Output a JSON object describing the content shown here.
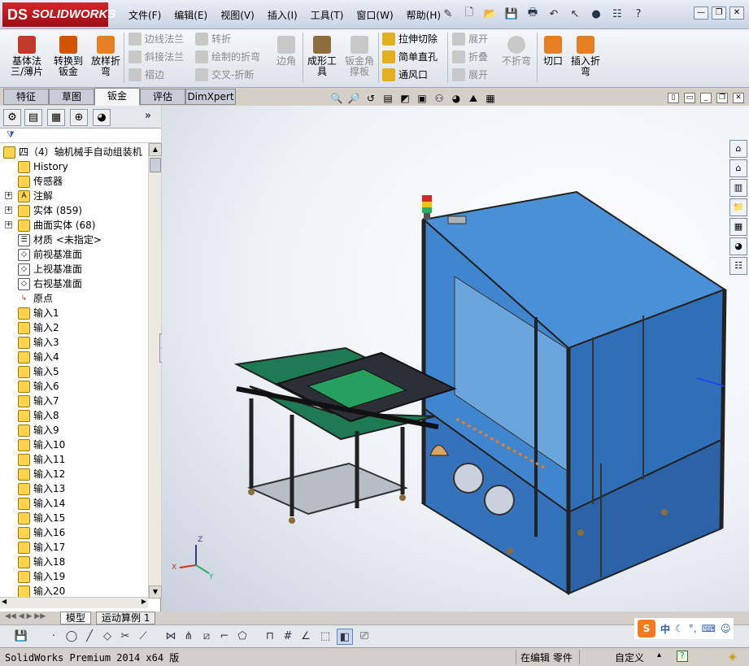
{
  "app": {
    "logo_prefix": "DS",
    "logo_text": "SOLIDWORKS"
  },
  "menubar": [
    {
      "label": "文件(F)"
    },
    {
      "label": "编辑(E)"
    },
    {
      "label": "视图(V)"
    },
    {
      "label": "插入(I)"
    },
    {
      "label": "工具(T)"
    },
    {
      "label": "窗口(W)"
    },
    {
      "label": "帮助(H)"
    }
  ],
  "ribbon": {
    "base_flange": "基体法\n三/薄片",
    "convert_to_sheet": "转换到\n钣金",
    "lofted_bend": "放样折\n弯",
    "edge_flange": "边线法兰",
    "miter_flange": "斜接法兰",
    "hem": "褶边",
    "jog": "转折",
    "sketched_bend": "绘制的折弯",
    "cross_break": "交叉-折断",
    "corner": "边角",
    "forming_tool": "成形工\n具",
    "gusset": "钣金角\n撑板",
    "extruded_cut": "拉伸切除",
    "simple_hole": "简单直孔",
    "vent": "通风口",
    "unfold": "展开",
    "fold": "折叠",
    "flatten": "展开",
    "no_bends": "不折弯",
    "rip": "切口",
    "insert_bends": "插入折\n弯"
  },
  "tabs": [
    {
      "label": "特征"
    },
    {
      "label": "草图"
    },
    {
      "label": "钣金"
    },
    {
      "label": "评估"
    },
    {
      "label": "DimXpert"
    }
  ],
  "tree": {
    "root": "四（4）轴机械手自动组装机",
    "items": [
      {
        "label": "History",
        "expand": false
      },
      {
        "label": "传感器",
        "expand": false
      },
      {
        "label": "注解",
        "expand": true
      },
      {
        "label": "实体 (859)",
        "expand": true
      },
      {
        "label": "曲面实体 (68)",
        "expand": true
      },
      {
        "label": "材质 <未指定>",
        "expand": false
      },
      {
        "label": "前视基准面",
        "expand": false
      },
      {
        "label": "上视基准面",
        "expand": false
      },
      {
        "label": "右视基准面",
        "expand": false
      },
      {
        "label": "原点",
        "expand": false
      },
      {
        "label": "输入1"
      },
      {
        "label": "输入2"
      },
      {
        "label": "输入3"
      },
      {
        "label": "输入4"
      },
      {
        "label": "输入5"
      },
      {
        "label": "输入6"
      },
      {
        "label": "输入7"
      },
      {
        "label": "输入8"
      },
      {
        "label": "输入9"
      },
      {
        "label": "输入10"
      },
      {
        "label": "输入11"
      },
      {
        "label": "输入12"
      },
      {
        "label": "输入13"
      },
      {
        "label": "输入14"
      },
      {
        "label": "输入15"
      },
      {
        "label": "输入16"
      },
      {
        "label": "输入17"
      },
      {
        "label": "输入18"
      },
      {
        "label": "输入19"
      },
      {
        "label": "输入20"
      }
    ]
  },
  "bottom_tabs": [
    {
      "label": "模型"
    },
    {
      "label": "运动算例 1"
    }
  ],
  "status": {
    "product": "SolidWorks Premium 2014 x64 版",
    "mode": "在编辑 零件",
    "units": "自定义"
  },
  "ime": {
    "brand": "S",
    "lang": "中"
  },
  "triad": {
    "x": "X",
    "y": "Y",
    "z": "Z"
  },
  "colors": {
    "cabinet_blue": "#2f6fb8",
    "cabinet_top": "#4a90d6",
    "frame": "#3a3d45",
    "conveyor_green": "#1e7a52",
    "accent_red": "#d8232a"
  }
}
